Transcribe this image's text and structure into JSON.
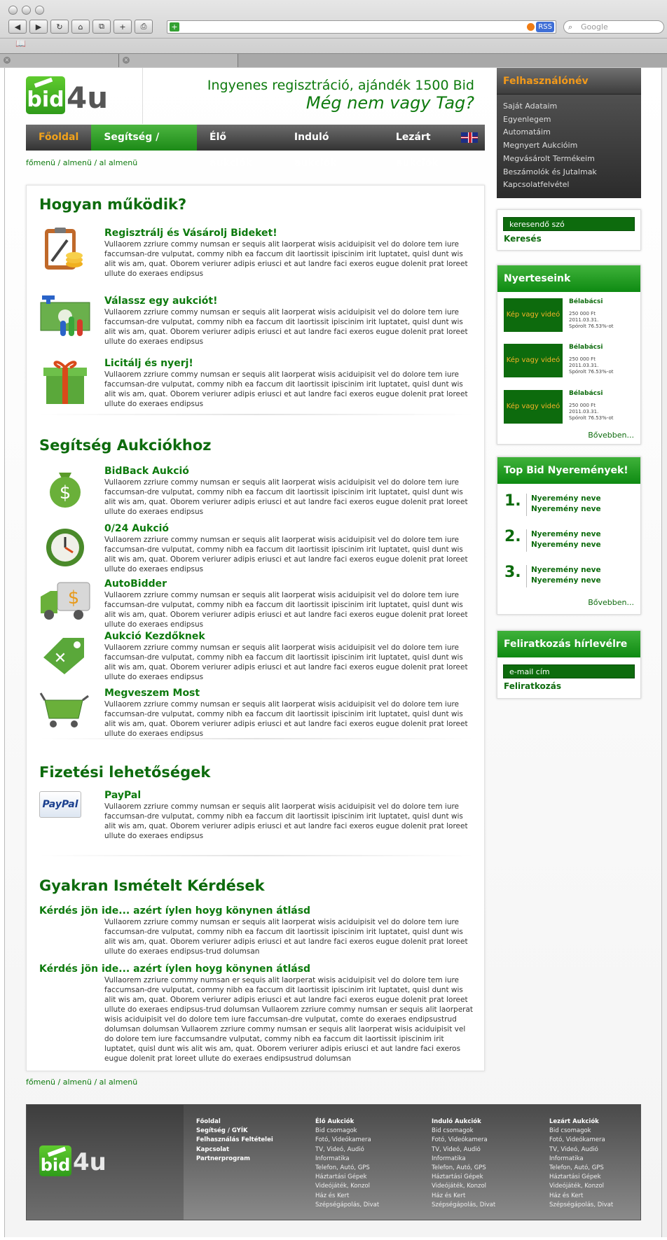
{
  "browser": {
    "buttons": [
      "◀",
      "▶",
      "↻",
      "⌂",
      "⧉",
      "+",
      "⎙"
    ],
    "address_value": "",
    "rss_label": "RSS",
    "search_placeholder": "Google",
    "bookmark_icon": "📖",
    "tabs": [
      "",
      ""
    ]
  },
  "header": {
    "logo_left": "bid",
    "logo_right": "4u",
    "tagline1": "Ingyenes regisztráció, ajándék 1500 Bid",
    "tagline2": "Még nem vagy Tag?"
  },
  "nav": {
    "items": [
      "Főoldal",
      "Segítség / GYÍK",
      "Élő aukciók",
      "Induló aukciók",
      "Lezárt aukciók"
    ]
  },
  "breadcrumb": "főmenü / almenü / al almenü",
  "lorem": "Vullaorem zzriure commy numsan er sequis alit laorperat wisis aciduipisit vel do dolore tem iure faccumsan-dre vulputat, commy nibh ea faccum dit laortissit ipiscinim irit luptatet, quisl dunt wis alit wis am, quat. Oborem veriurer adipis eriusci et aut landre faci exeros eugue dolenit prat loreet ullute do exeraes endipsus",
  "sections": {
    "how": {
      "title": "Hogyan működik?",
      "items": [
        "Regisztrálj és Vásárolj Bideket!",
        "Válassz egy aukciót!",
        "Licitálj és nyerj!"
      ]
    },
    "help": {
      "title": "Segítség Aukciókhoz",
      "items": [
        "BidBack Aukció",
        "0/24 Aukció",
        "AutoBidder",
        "Aukció Kezdőknek",
        "Megveszem Most"
      ]
    },
    "pay": {
      "title": "Fizetési lehetőségek",
      "items": [
        "PayPal"
      ],
      "paypal_logo": "PayPal"
    },
    "faq": {
      "title": "Gyakran Ismételt Kérdések",
      "q1": "Kérdés jön ide... azért íylen hoyg könynen átlásd",
      "a1": "Vullaorem zzriure commy numsan er sequis alit laorperat wisis aciduipisit vel do dolore tem iure faccumsan-dre vulputat, commy nibh ea faccum dit laortissit ipiscinim irit luptatet, quisl dunt wis alit wis am, quat. Oborem veriurer adipis eriusci et aut landre faci exeros eugue dolenit prat loreet ullute do exeraes endipsus-trud dolumsan",
      "q2": "Kérdés jön ide... azért íylen hoyg könynen átlásd",
      "a2": "Vullaorem zzriure commy numsan er sequis alit laorperat wisis aciduipisit vel do dolore tem iure faccumsan-dre vulputat, commy nibh ea faccum dit laortissit ipiscinim irit luptatet, quisl dunt wis alit wis am, quat. Oborem veriurer adipis eriusci et aut landre faci exeros eugue dolenit prat loreet ullute do exeraes endipsus-trud dolumsan Vullaorem zzriure commy numsan er sequis alit laorperat wisis aciduipisit vel do dolore tem iure faccumsan-dre vulputat, comte do exeraes endipsustrud dolumsan  dolumsan Vullaorem zzriure commy numsan er sequis alit laorperat wisis aciduipisit vel do dolore tem iure faccumsandre vulputat, commy nibh ea faccum dit laortissit ipiscinim irit luptatet, quisl dunt wis alit wis am, quat. Oborem veriurer adipis eriusci et aut landre faci exeros eugue dolenit prat loreet ullute do exeraes endipsustrud dolumsan"
    }
  },
  "sidebar": {
    "user": {
      "title": "Felhasználónév",
      "items": [
        "Saját Adataim",
        "Egyenlegem",
        "Automatáim",
        "Megnyert Aukcióim",
        "Megvásárolt Termékeim",
        "Beszámolók és Jutalmak",
        "Kapcsolatfelvétel"
      ]
    },
    "search": {
      "placeholder": "keresendő szó",
      "button": "Keresés"
    },
    "winners": {
      "title": "Nyerteseink",
      "img_label": "Kép vagy videó",
      "name": "Bélabácsi",
      "price": "250 000 Ft",
      "date": "2011.03.31.",
      "saved": "Spórolt 76.53%-ot",
      "more": "Bővebben..."
    },
    "topbid": {
      "title": "Top Bid Nyeremények!",
      "items": [
        {
          "num": "1.",
          "a": "Nyeremény neve",
          "b": "Nyeremény neve"
        },
        {
          "num": "2.",
          "a": "Nyeremény neve",
          "b": "Nyeremény neve"
        },
        {
          "num": "3.",
          "a": "Nyeremény neve",
          "b": "Nyeremény neve"
        }
      ],
      "more": "Bővebben..."
    },
    "newsletter": {
      "title": "Feliratkozás hírlevélre",
      "placeholder": "e-mail cím",
      "button": "Feliratkozás"
    }
  },
  "footer": {
    "col1": [
      "Főoldal",
      "Segítség / GYÍK",
      "Felhasználás Feltételei",
      "Kapcsolat",
      "Partnerprogram"
    ],
    "col2_title": "Élő Aukciók",
    "col3_title": "Induló Aukciók",
    "col4_title": "Lezárt Aukciók",
    "cats": [
      "Bid csomagok",
      "Fotó, Videókamera",
      "TV, Videó, Audió",
      "Informatika",
      "Telefon, Autó, GPS",
      "Háztartási Gépek",
      "Videójáték, Konzol",
      "Ház és Kert",
      "Szépségápolás, Divat"
    ]
  },
  "colors": {
    "green": "#0d7a0d",
    "orange": "#f39a1a",
    "dark": "#333333"
  }
}
